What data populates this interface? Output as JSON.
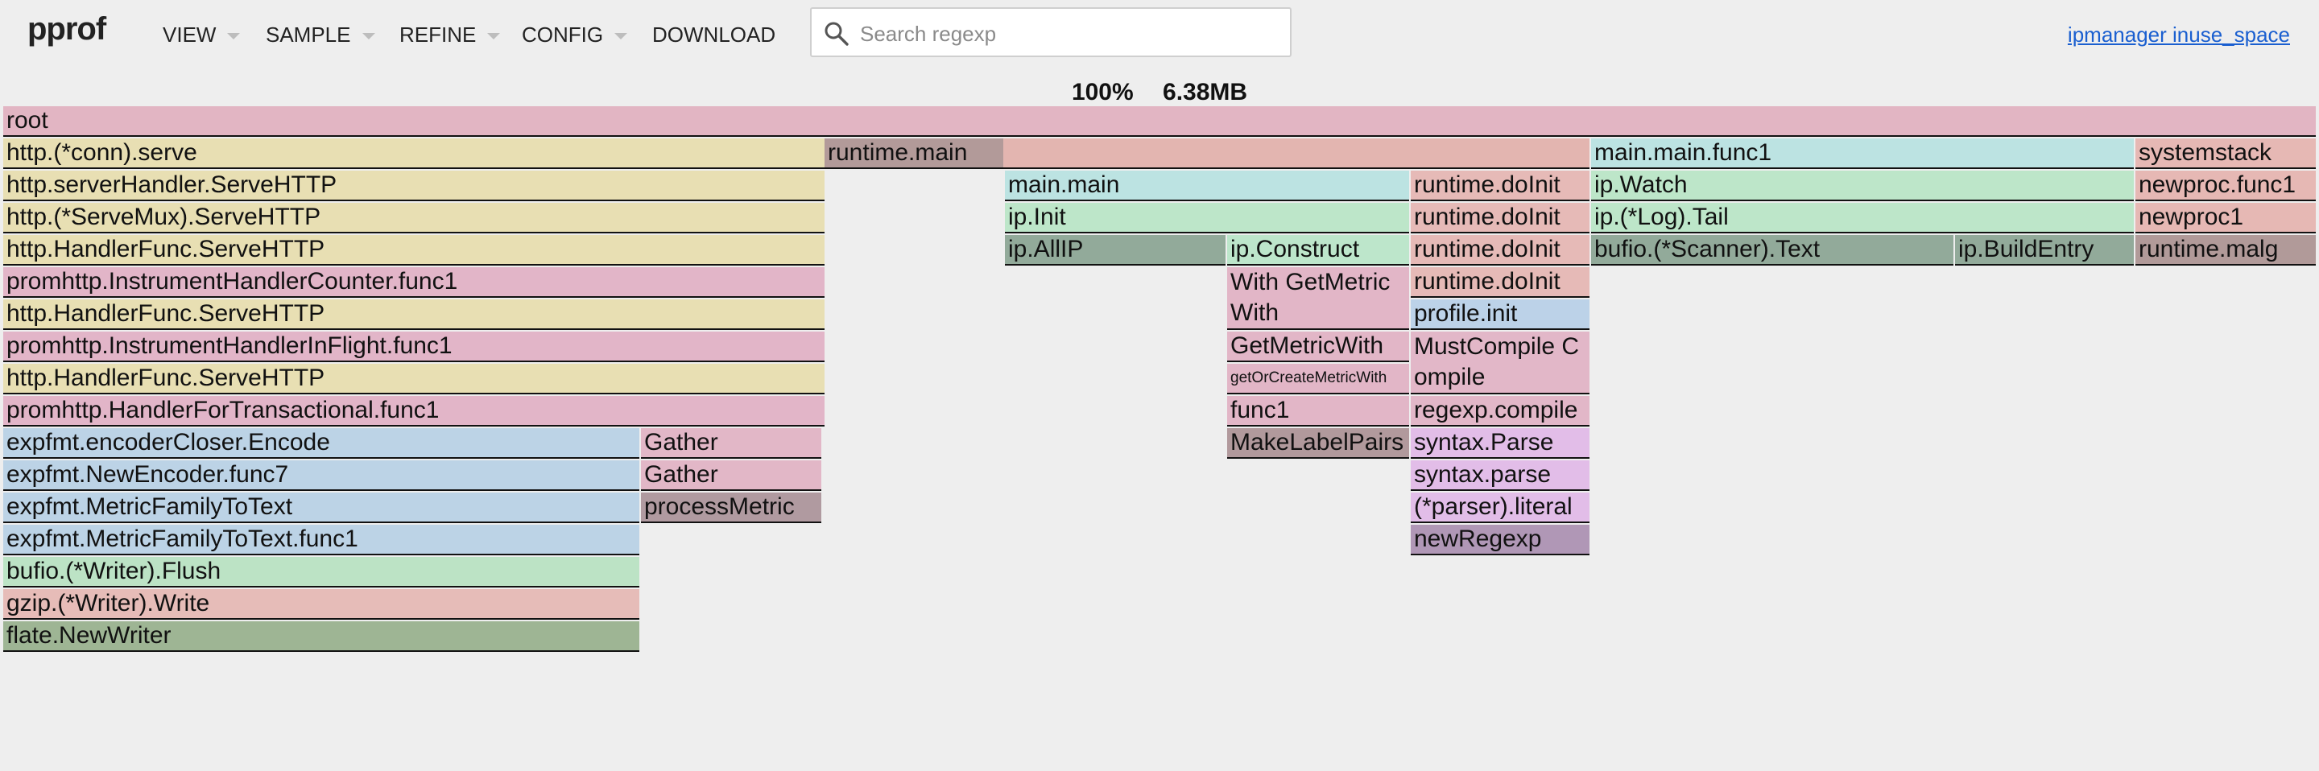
{
  "header": {
    "logo": "pprof",
    "menu": [
      "VIEW",
      "SAMPLE",
      "REFINE",
      "CONFIG",
      "DOWNLOAD"
    ],
    "search_placeholder": "Search regexp",
    "profile_link": "ipmanager inuse_space"
  },
  "status": {
    "percent": "100%",
    "size": "6.38MB"
  },
  "colors": {
    "root": "#e2b5c3",
    "http": "#e8dfb3",
    "prom": "#e2b5c8",
    "expfmt": "#bcd3e6",
    "bufio": "#bce3c5",
    "gzip": "#e6bcb8",
    "flate": "#9eb594",
    "gather": "#e2b7c7",
    "process": "#b09aa0",
    "runtime_main": "#b29a99",
    "runtime_wide": "#e3b5b0",
    "main": "#bce3e2",
    "ip": "#bde6c9",
    "allip": "#92aa9a",
    "construct": "#bde6cb",
    "getmetric": "#e2b6c7",
    "makelabel": "#b1999c",
    "doinit": "#e6bab7",
    "profile": "#bcd2e8",
    "mustcompile": "#e2b7c8",
    "syntax": "#e2bde8",
    "newregexp": "#b097b6",
    "systemstack": "#e6b8b4",
    "malg": "#b19a99"
  },
  "frames": [
    {
      "label": "root",
      "depth": 0,
      "color": "root"
    },
    {
      "label": "http.(*conn).serve",
      "depth": 1,
      "color": "http"
    },
    {
      "label": "http.serverHandler.ServeHTTP",
      "depth": 2,
      "color": "http"
    },
    {
      "label": "http.(*ServeMux).ServeHTTP",
      "depth": 3,
      "color": "http"
    },
    {
      "label": "http.HandlerFunc.ServeHTTP",
      "depth": 4,
      "color": "http"
    },
    {
      "label": "promhttp.InstrumentHandlerCounter.func1",
      "depth": 5,
      "color": "prom"
    },
    {
      "label": "http.HandlerFunc.ServeHTTP",
      "depth": 6,
      "color": "http"
    },
    {
      "label": "promhttp.InstrumentHandlerInFlight.func1",
      "depth": 7,
      "color": "prom"
    },
    {
      "label": "http.HandlerFunc.ServeHTTP",
      "depth": 8,
      "color": "http"
    },
    {
      "label": "promhttp.HandlerForTransactional.func1",
      "depth": 9,
      "color": "prom"
    },
    {
      "label": "expfmt.encoderCloser.Encode",
      "depth": 10,
      "color": "expfmt"
    },
    {
      "label": "expfmt.NewEncoder.func7",
      "depth": 11,
      "color": "expfmt"
    },
    {
      "label": "expfmt.MetricFamilyToText",
      "depth": 12,
      "color": "expfmt"
    },
    {
      "label": "expfmt.MetricFamilyToText.func1",
      "depth": 13,
      "color": "expfmt"
    },
    {
      "label": "bufio.(*Writer).Flush",
      "depth": 14,
      "color": "bufio"
    },
    {
      "label": "gzip.(*Writer).Write",
      "depth": 15,
      "color": "gzip"
    },
    {
      "label": "flate.NewWriter",
      "depth": 16,
      "color": "flate"
    },
    {
      "label": "Gather",
      "depth": 10,
      "color": "gather"
    },
    {
      "label": "Gather",
      "depth": 11,
      "color": "gather"
    },
    {
      "label": "processMetric",
      "depth": 12,
      "color": "process"
    },
    {
      "label": "runtime.main",
      "depth": 1,
      "color": "runtime_main"
    },
    {
      "label": "",
      "depth": 1,
      "color": "runtime_wide"
    },
    {
      "label": "main.main",
      "depth": 2,
      "color": "main"
    },
    {
      "label": "ip.Init",
      "depth": 3,
      "color": "ip"
    },
    {
      "label": "ip.AllIP",
      "depth": 4,
      "color": "allip"
    },
    {
      "label": "ip.Construct",
      "depth": 4,
      "color": "construct"
    },
    {
      "label": "With GetMetricWith",
      "depth": 5,
      "color": "getmetric"
    },
    {
      "label": "GetMetricWith",
      "depth": 7,
      "color": "getmetric"
    },
    {
      "label": "getOrCreateMetricWith",
      "depth": 8,
      "color": "getmetric"
    },
    {
      "label": "func1",
      "depth": 9,
      "color": "getmetric"
    },
    {
      "label": "MakeLabelPairs",
      "depth": 10,
      "color": "makelabel"
    },
    {
      "label": "runtime.doInit",
      "depth": 2,
      "color": "doinit"
    },
    {
      "label": "runtime.doInit",
      "depth": 3,
      "color": "doinit"
    },
    {
      "label": "runtime.doInit",
      "depth": 4,
      "color": "doinit"
    },
    {
      "label": "runtime.doInit",
      "depth": 5,
      "color": "doinit"
    },
    {
      "label": "profile.init",
      "depth": 6,
      "color": "profile"
    },
    {
      "label": "MustCompile Compile",
      "depth": 7,
      "color": "mustcompile"
    },
    {
      "label": "regexp.compile",
      "depth": 9,
      "color": "mustcompile"
    },
    {
      "label": "syntax.Parse",
      "depth": 10,
      "color": "syntax"
    },
    {
      "label": "syntax.parse",
      "depth": 11,
      "color": "syntax"
    },
    {
      "label": "(*parser).literal",
      "depth": 12,
      "color": "syntax"
    },
    {
      "label": "newRegexp",
      "depth": 13,
      "color": "newregexp"
    },
    {
      "label": "main.main.func1",
      "depth": 1,
      "color": "main"
    },
    {
      "label": "ip.Watch",
      "depth": 2,
      "color": "ip"
    },
    {
      "label": "ip.(*Log).Tail",
      "depth": 3,
      "color": "ip"
    },
    {
      "label": "bufio.(*Scanner).Text",
      "depth": 4,
      "color": "allip"
    },
    {
      "label": "ip.BuildEntry",
      "depth": 4,
      "color": "allip"
    },
    {
      "label": "systemstack",
      "depth": 1,
      "color": "systemstack"
    },
    {
      "label": "newproc.func1",
      "depth": 2,
      "color": "systemstack"
    },
    {
      "label": "newproc1",
      "depth": 3,
      "color": "systemstack"
    },
    {
      "label": "runtime.malg",
      "depth": 4,
      "color": "malg"
    }
  ]
}
